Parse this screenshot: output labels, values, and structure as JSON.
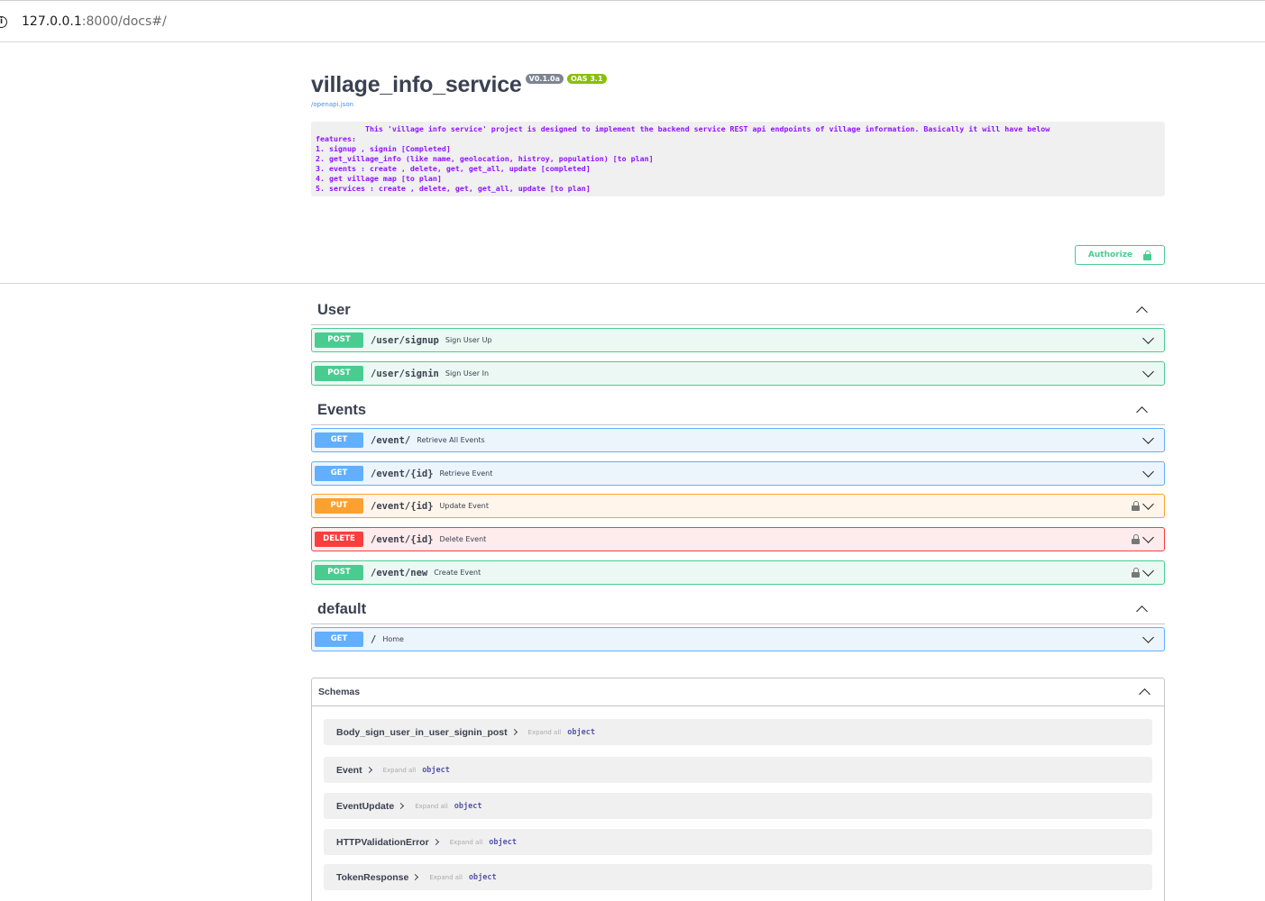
{
  "browser": {
    "url_host": "127.0.0.1",
    "url_rest": ":8000/docs#/"
  },
  "info": {
    "title": "village_info_service",
    "version_badge": "V0.1.0a",
    "oas_badge": "OAS 3.1",
    "openapi_link": "/openapi.json",
    "description": "           This 'village info service' project is designed to implement the backend service REST api endpoints of village information. Basically it will have below\nfeatures:\n1. signup , signin [Completed]\n2. get_village_info (like name, geolocation, histroy, population) [to plan]\n3. events : create , delete, get, get_all, update [completed]\n4. get village map [to plan]\n5. services : create , delete, get, get_all, update [to plan]"
  },
  "authorize_label": "Authorize",
  "tags": [
    {
      "name": "User",
      "operations": [
        {
          "method": "POST",
          "path": "/user/signup",
          "summary": "Sign User Up",
          "locked": false
        },
        {
          "method": "POST",
          "path": "/user/signin",
          "summary": "Sign User In",
          "locked": false
        }
      ]
    },
    {
      "name": "Events",
      "operations": [
        {
          "method": "GET",
          "path": "/event/",
          "summary": "Retrieve All Events",
          "locked": false
        },
        {
          "method": "GET",
          "path": "/event/{id}",
          "summary": "Retrieve Event",
          "locked": false
        },
        {
          "method": "PUT",
          "path": "/event/{id}",
          "summary": "Update Event",
          "locked": true
        },
        {
          "method": "DELETE",
          "path": "/event/{id}",
          "summary": "Delete Event",
          "locked": true
        },
        {
          "method": "POST",
          "path": "/event/new",
          "summary": "Create Event",
          "locked": true
        }
      ]
    },
    {
      "name": "default",
      "operations": [
        {
          "method": "GET",
          "path": "/",
          "summary": "Home",
          "locked": false
        }
      ]
    }
  ],
  "schemas": {
    "title": "Schemas",
    "expand_all_label": "Expand all",
    "type_label": "object",
    "models": [
      "Body_sign_user_in_user_signin_post",
      "Event",
      "EventUpdate",
      "HTTPValidationError",
      "TokenResponse"
    ]
  },
  "colors": {
    "post": "#49cc90",
    "get": "#61affe",
    "put": "#fca130",
    "delete": "#f93e3e"
  }
}
